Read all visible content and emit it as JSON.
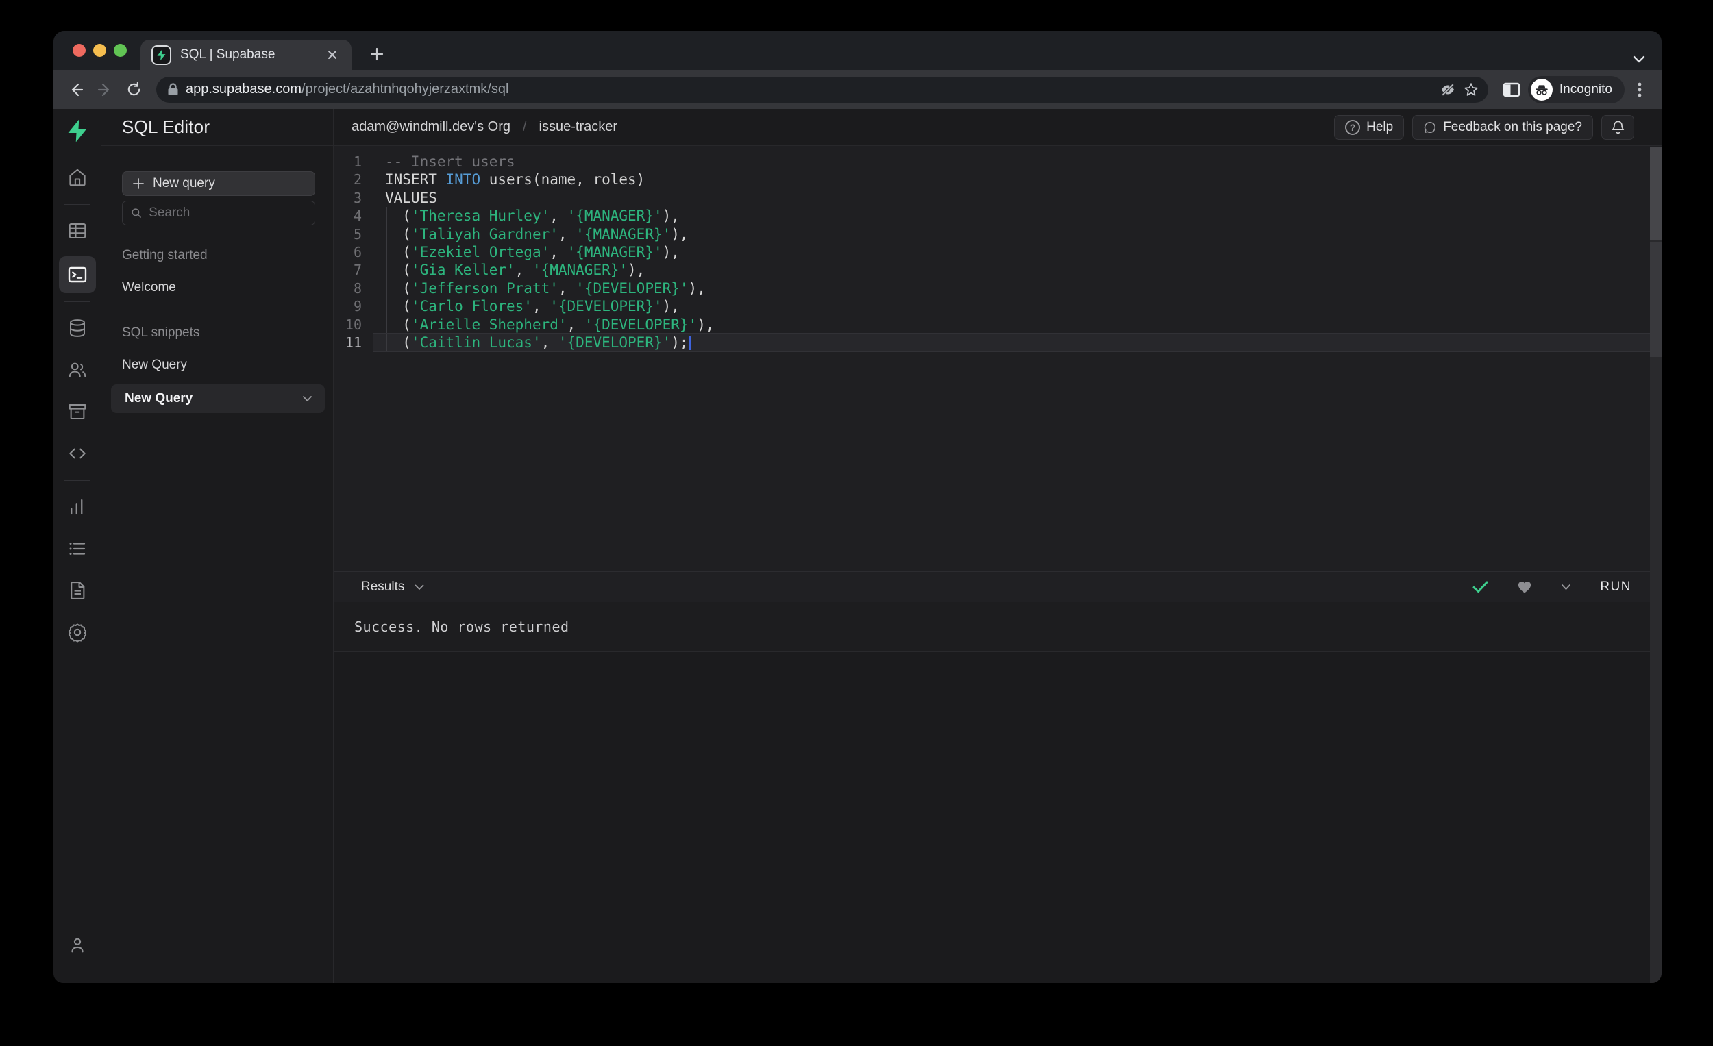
{
  "browser": {
    "tab_title": "SQL | Supabase",
    "url_domain": "app.supabase.com",
    "url_path": "/project/azahtnhqohyjerzaxtmk/sql",
    "incognito_label": "Incognito"
  },
  "rail": {
    "icons": [
      "supabase-logo",
      "home",
      "table-editor",
      "sql-editor",
      "database",
      "authentication",
      "storage",
      "edge-functions",
      "reports",
      "logs",
      "api-docs",
      "settings",
      "account"
    ],
    "active": "sql-editor"
  },
  "sidebar": {
    "title": "SQL Editor",
    "new_query_button": "New query",
    "search_placeholder": "Search",
    "sections": [
      {
        "label": "Getting started",
        "items": [
          "Welcome"
        ]
      },
      {
        "label": "SQL snippets",
        "items": [
          "New Query"
        ]
      }
    ],
    "active_item": "New Query"
  },
  "header": {
    "breadcrumb": [
      "adam@windmill.dev's Org",
      "issue-tracker"
    ],
    "help_button": "Help",
    "feedback_button": "Feedback on this page?"
  },
  "editor": {
    "language": "sql",
    "lines": [
      {
        "n": "1",
        "tokens": [
          [
            "comment",
            "-- Insert users"
          ]
        ]
      },
      {
        "n": "2",
        "tokens": [
          [
            "plain",
            "INSERT "
          ],
          [
            "keyword",
            "INTO"
          ],
          [
            "plain",
            " users(name, roles)"
          ]
        ]
      },
      {
        "n": "3",
        "tokens": [
          [
            "plain",
            "VALUES"
          ]
        ]
      },
      {
        "n": "4",
        "guide": true,
        "tokens": [
          [
            "plain",
            "  ("
          ],
          [
            "string",
            "'Theresa Hurley'"
          ],
          [
            "plain",
            ", "
          ],
          [
            "string",
            "'{MANAGER}'"
          ],
          [
            "plain",
            "),"
          ]
        ]
      },
      {
        "n": "5",
        "guide": true,
        "tokens": [
          [
            "plain",
            "  ("
          ],
          [
            "string",
            "'Taliyah Gardner'"
          ],
          [
            "plain",
            ", "
          ],
          [
            "string",
            "'{MANAGER}'"
          ],
          [
            "plain",
            "),"
          ]
        ]
      },
      {
        "n": "6",
        "guide": true,
        "tokens": [
          [
            "plain",
            "  ("
          ],
          [
            "string",
            "'Ezekiel Ortega'"
          ],
          [
            "plain",
            ", "
          ],
          [
            "string",
            "'{MANAGER}'"
          ],
          [
            "plain",
            "),"
          ]
        ]
      },
      {
        "n": "7",
        "guide": true,
        "tokens": [
          [
            "plain",
            "  ("
          ],
          [
            "string",
            "'Gia Keller'"
          ],
          [
            "plain",
            ", "
          ],
          [
            "string",
            "'{MANAGER}'"
          ],
          [
            "plain",
            "),"
          ]
        ]
      },
      {
        "n": "8",
        "guide": true,
        "tokens": [
          [
            "plain",
            "  ("
          ],
          [
            "string",
            "'Jefferson Pratt'"
          ],
          [
            "plain",
            ", "
          ],
          [
            "string",
            "'{DEVELOPER}'"
          ],
          [
            "plain",
            "),"
          ]
        ]
      },
      {
        "n": "9",
        "guide": true,
        "tokens": [
          [
            "plain",
            "  ("
          ],
          [
            "string",
            "'Carlo Flores'"
          ],
          [
            "plain",
            ", "
          ],
          [
            "string",
            "'{DEVELOPER}'"
          ],
          [
            "plain",
            "),"
          ]
        ]
      },
      {
        "n": "10",
        "guide": true,
        "tokens": [
          [
            "plain",
            "  ("
          ],
          [
            "string",
            "'Arielle Shepherd'"
          ],
          [
            "plain",
            ", "
          ],
          [
            "string",
            "'{DEVELOPER}'"
          ],
          [
            "plain",
            "),"
          ]
        ]
      },
      {
        "n": "11",
        "guide": true,
        "active": true,
        "cursor": true,
        "tokens": [
          [
            "plain",
            "  ("
          ],
          [
            "string",
            "'Caitlin Lucas'"
          ],
          [
            "plain",
            ", "
          ],
          [
            "string",
            "'{DEVELOPER}'"
          ],
          [
            "plain",
            ");"
          ]
        ]
      }
    ]
  },
  "results": {
    "label": "Results",
    "run_button": "RUN",
    "message": "Success. No rows returned"
  },
  "colors": {
    "brand_green": "#3ecf8e",
    "string_green": "#2db57e",
    "keyword_blue": "#569cd6",
    "success_check": "#3ecf8e",
    "traffic_red": "#ee6a5f",
    "traffic_yellow": "#f5bd4f",
    "traffic_green": "#61c454"
  }
}
